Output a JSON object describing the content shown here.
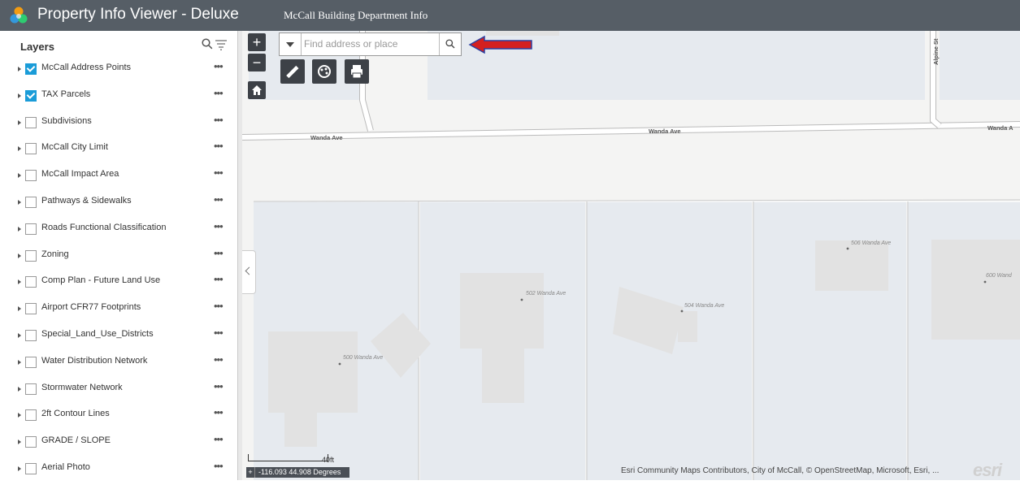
{
  "header": {
    "app_title": "Property Info Viewer - Deluxe",
    "subtitle": "McCall Building Department Info",
    "bg_color": "#565e66"
  },
  "layers_panel": {
    "title": "Layers",
    "search_icon": "search-icon",
    "filter_icon": "filter-icon",
    "layers": [
      {
        "label": "McCall Address Points",
        "checked": true
      },
      {
        "label": "TAX Parcels",
        "checked": true
      },
      {
        "label": "Subdivisions",
        "checked": false
      },
      {
        "label": "McCall City Limit",
        "checked": false
      },
      {
        "label": "McCall Impact Area",
        "checked": false
      },
      {
        "label": "Pathways & Sidewalks",
        "checked": false
      },
      {
        "label": "Roads Functional Classification",
        "checked": false
      },
      {
        "label": "Zoning",
        "checked": false
      },
      {
        "label": "Comp Plan - Future Land Use",
        "checked": false
      },
      {
        "label": "Airport CFR77 Footprints",
        "checked": false
      },
      {
        "label": "Special_Land_Use_Districts",
        "checked": false
      },
      {
        "label": "Water Distribution Network",
        "checked": false
      },
      {
        "label": "Stormwater Network",
        "checked": false
      },
      {
        "label": "2ft Contour Lines",
        "checked": false
      },
      {
        "label": "GRADE / SLOPE",
        "checked": false
      },
      {
        "label": "Aerial Photo",
        "checked": false
      }
    ],
    "menu_glyph": "•••",
    "check_color": "#1a9cd8"
  },
  "map": {
    "zoom_in": "+",
    "zoom_out": "−",
    "search": {
      "placeholder": "Find address or place",
      "value": ""
    },
    "streets": {
      "wanda_ave": "Wanda Ave",
      "wanda_ave_cut": "Wanda A",
      "alpine": "Alpine St"
    },
    "addresses": {
      "a500": "500 Wanda Ave",
      "a502": "502 Wanda Ave",
      "a504": "504 Wanda Ave",
      "a506": "506 Wanda Ave",
      "a600": "600 Wand"
    },
    "scale_label": "40ft",
    "coords_plus": "+",
    "coordinates": "-116.093 44.908 Degrees",
    "attribution": "Esri Community Maps Contributors, City of McCall, © OpenStreetMap, Microsoft, Esri, ...",
    "logo_text": "esri",
    "arrow_color": "#d42020",
    "parcel_color": "#e6eaef",
    "building_color": "#e2e2e2"
  }
}
